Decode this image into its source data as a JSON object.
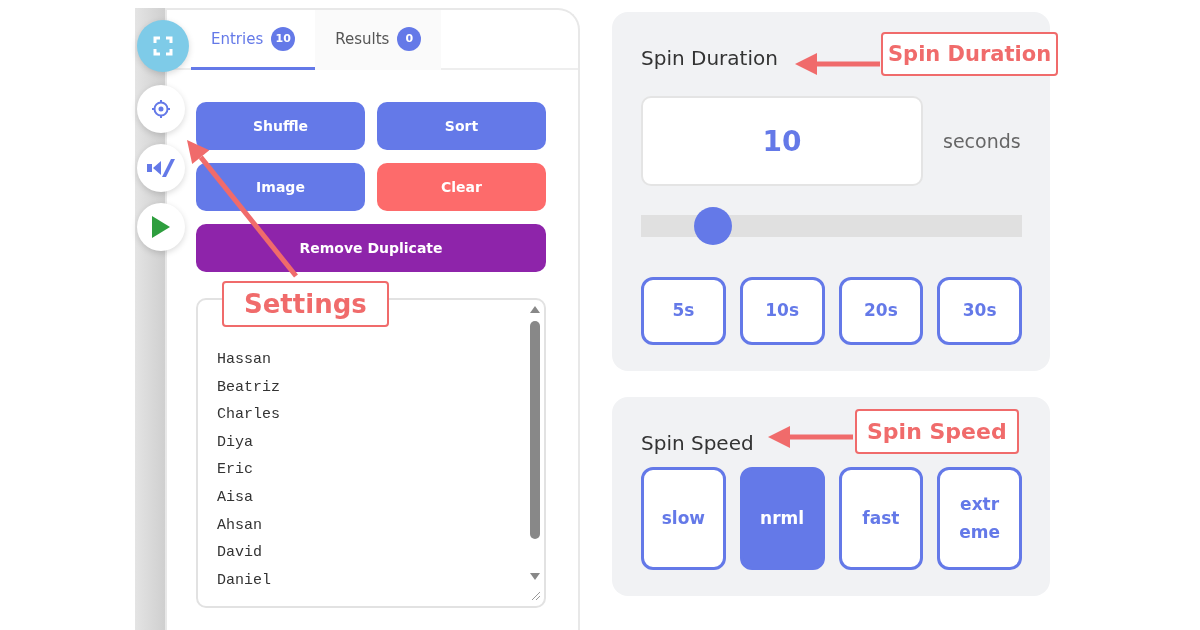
{
  "sidebar": {
    "buttons": [
      {
        "kind": "fullscreen"
      },
      {
        "kind": "settings"
      },
      {
        "kind": "code"
      },
      {
        "kind": "play"
      }
    ]
  },
  "tabs": [
    {
      "label": "Entries",
      "count": "10",
      "selected": true
    },
    {
      "label": "Results",
      "count": "0",
      "selected": false
    }
  ],
  "actions": [
    {
      "label": "Shuffle",
      "kind": "primary"
    },
    {
      "label": "Sort",
      "kind": "primary"
    },
    {
      "label": "Image",
      "kind": "primary"
    },
    {
      "label": "Clear",
      "kind": "danger"
    },
    {
      "label": "Remove Duplicate",
      "kind": "wide"
    }
  ],
  "entries": [
    "Hassan",
    "Beatriz",
    "Charles",
    "Diya",
    "Eric",
    "Aisa",
    "Ahsan",
    "David",
    "Daniel"
  ],
  "duration": {
    "title": "Spin Duration",
    "value": "10",
    "unit": "seconds",
    "level": 0.19,
    "presets": [
      {
        "label": "5s",
        "selected": false
      },
      {
        "label": "10s",
        "selected": false
      },
      {
        "label": "20s",
        "selected": false
      },
      {
        "label": "30s",
        "selected": false
      }
    ]
  },
  "speed": {
    "title": "Spin Speed",
    "options": [
      {
        "label": "slow",
        "selected": false
      },
      {
        "label": "nrml",
        "selected": true
      },
      {
        "label": "fast",
        "selected": false
      },
      {
        "label": "extr eme",
        "selected": false
      }
    ]
  },
  "callouts": [
    {
      "kind": "settings",
      "text": "Settings"
    },
    {
      "kind": "duration",
      "text": "Spin Duration"
    },
    {
      "kind": "speed",
      "text": "Spin Speed"
    }
  ]
}
